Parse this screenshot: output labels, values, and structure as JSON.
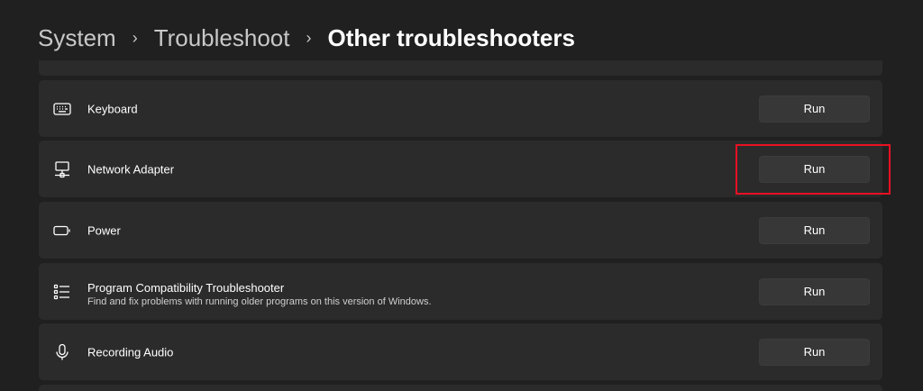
{
  "breadcrumb": {
    "items": [
      "System",
      "Troubleshoot",
      "Other troubleshooters"
    ],
    "separator": "›"
  },
  "troubleshooters": [
    {
      "id": "keyboard",
      "label": "Keyboard",
      "icon": "keyboard-icon",
      "button": "Run"
    },
    {
      "id": "network-adapter",
      "label": "Network Adapter",
      "icon": "network-adapter-icon",
      "button": "Run",
      "highlighted": true
    },
    {
      "id": "power",
      "label": "Power",
      "icon": "battery-icon",
      "button": "Run"
    },
    {
      "id": "program-compatibility",
      "label": "Program Compatibility Troubleshooter",
      "description": "Find and fix problems with running older programs on this version of Windows.",
      "icon": "list-icon",
      "button": "Run"
    },
    {
      "id": "recording-audio",
      "label": "Recording Audio",
      "icon": "microphone-icon",
      "button": "Run"
    }
  ],
  "colors": {
    "background": "#202020",
    "card": "#2b2b2b",
    "button": "#373737",
    "highlight": "#e81123"
  }
}
